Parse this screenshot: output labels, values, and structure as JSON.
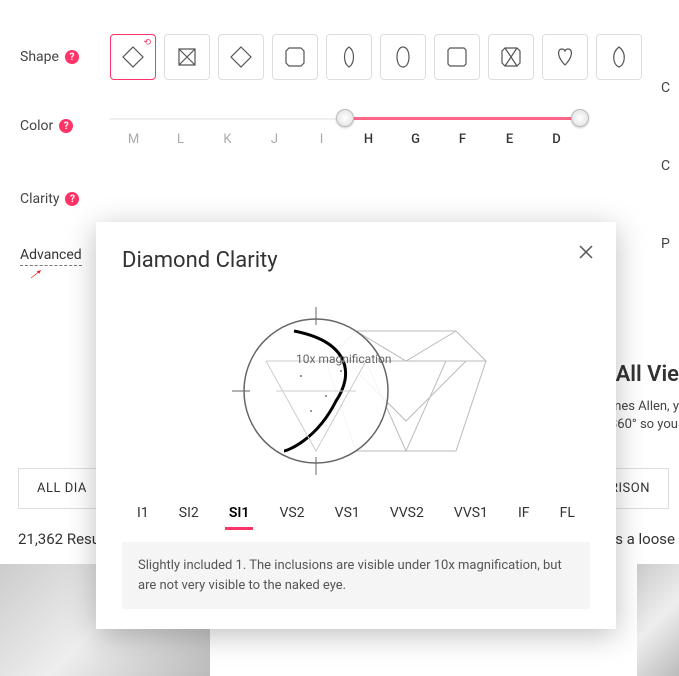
{
  "filters": {
    "shape_label": "Shape",
    "color_label": "Color",
    "clarity_label": "Clarity",
    "right_cut": [
      "C",
      "C",
      "P"
    ]
  },
  "shapes": [
    "round",
    "princess",
    "cushion",
    "emerald",
    "marquise",
    "oval",
    "radiant",
    "asscher",
    "heart",
    "pear"
  ],
  "color": {
    "grades": [
      "M",
      "L",
      "K",
      "J",
      "I",
      "H",
      "G",
      "F",
      "E",
      "D"
    ],
    "active_from": 5,
    "active_to": 9
  },
  "advanced_label": "Advanced",
  "results": {
    "all_tab": "ALL DIA",
    "comp_tab": "RISON",
    "count": "21,362 Resul",
    "loose": "as a loose"
  },
  "allview": {
    "title": "All Vie",
    "line1": "mes Allen, y",
    "line2": "360° so you"
  },
  "modal": {
    "title": "Diamond Clarity",
    "mag_label": "10x magnification",
    "tabs": [
      "I1",
      "SI2",
      "SI1",
      "VS2",
      "VS1",
      "VVS2",
      "VVS1",
      "IF",
      "FL"
    ],
    "active_tab": "SI1",
    "description": "Slightly included 1. The inclusions are visible under 10x magnification, but are not very visible to the naked eye."
  }
}
